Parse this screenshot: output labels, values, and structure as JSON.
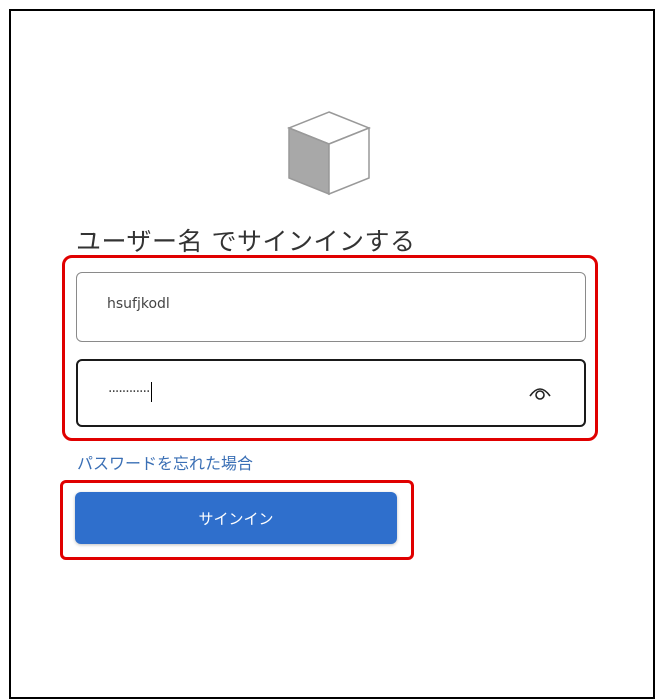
{
  "title": "ユーザー名 でサインインする",
  "username_field": {
    "value": "hsufjkodl"
  },
  "password_field": {
    "masked_value": "············",
    "reveal_icon": "eye-icon"
  },
  "forgot_password_link": "パスワードを忘れた場合",
  "signin_button_label": "サインイン",
  "logo_icon": "cube-icon",
  "colors": {
    "button": "#2f6fcc",
    "link": "#3a6fb5",
    "highlight": "#e00000",
    "text": "#333333"
  }
}
